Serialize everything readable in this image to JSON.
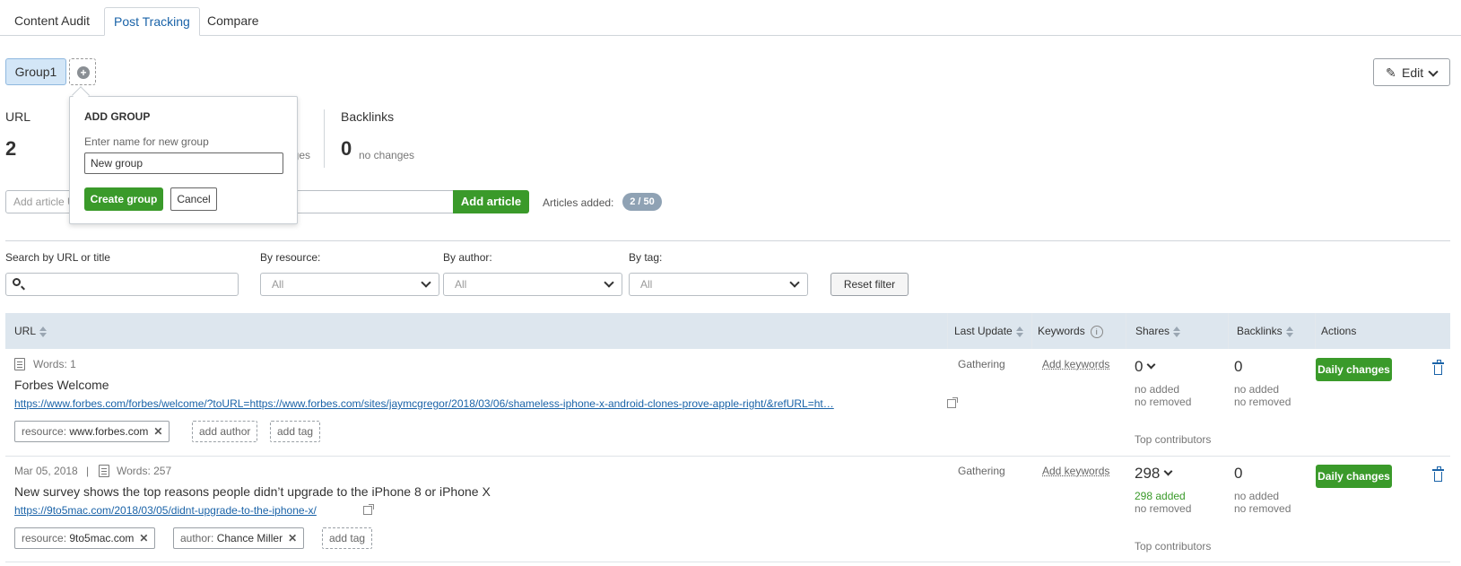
{
  "tabs": [
    {
      "label": "Content Audit"
    },
    {
      "label": "Post Tracking"
    },
    {
      "label": "Compare"
    }
  ],
  "groups": {
    "current": "Group1"
  },
  "edit_label": "Edit",
  "stats": {
    "url_label": "URL",
    "url_value": "2",
    "changes_suffix": "nges",
    "backlinks_label": "Backlinks",
    "backlinks_value": "0",
    "backlinks_sub": "no changes"
  },
  "add_article": {
    "placeholder": "Add article URL",
    "button": "Add article",
    "count_label": "Articles added:",
    "count": "2 / 50"
  },
  "filters": {
    "search_label": "Search by URL or title",
    "resource_label": "By resource:",
    "author_label": "By author:",
    "tag_label": "By tag:",
    "resource_value": "All",
    "author_value": "All",
    "tag_value": "All",
    "reset": "Reset filter"
  },
  "table": {
    "headers": {
      "url": "URL",
      "last_update": "Last Update",
      "keywords": "Keywords",
      "shares": "Shares",
      "backlinks": "Backlinks",
      "actions": "Actions"
    },
    "rows": [
      {
        "date": "",
        "words": "Words: 1",
        "title": "Forbes Welcome",
        "url": "https://www.forbes.com/forbes/welcome/?toURL=https://www.forbes.com/sites/jaymcgregor/2018/03/06/shameless-iphone-x-android-clones-prove-apple-right/&refURL=ht…",
        "resource_key": "resource:",
        "resource_val": "www.forbes.com",
        "author_add": "add author",
        "tag_add": "add tag",
        "status": "Gathering",
        "add_keywords": "Add keywords",
        "shares": "0",
        "shares_added": "no added",
        "shares_removed": "no removed",
        "top_contributors": "Top contributors",
        "backlinks": "0",
        "bl_added": "no added",
        "bl_removed": "no removed",
        "action": "Daily changes"
      },
      {
        "date": "Mar 05, 2018",
        "sep": "|",
        "words": "Words: 257",
        "title": "New survey shows the top reasons people didn’t upgrade to the iPhone 8 or iPhone X",
        "url": "https://9to5mac.com/2018/03/05/didnt-upgrade-to-the-iphone-x/",
        "resource_key": "resource:",
        "resource_val": "9to5mac.com",
        "author_key": "author:",
        "author_val": "Chance Miller",
        "tag_add": "add tag",
        "status": "Gathering",
        "add_keywords": "Add keywords",
        "shares": "298",
        "shares_added": "298 added",
        "shares_removed": "no removed",
        "top_contributors": "Top contributors",
        "backlinks": "0",
        "bl_added": "no added",
        "bl_removed": "no removed",
        "action": "Daily changes"
      }
    ]
  },
  "popup": {
    "title": "ADD GROUP",
    "hint": "Enter name for new group",
    "input_value": "New group",
    "create": "Create group",
    "cancel": "Cancel"
  },
  "colors": {
    "accent_green": "#3a9a2a",
    "link_blue": "#1a63a8",
    "header_bg": "#dde6ee"
  }
}
